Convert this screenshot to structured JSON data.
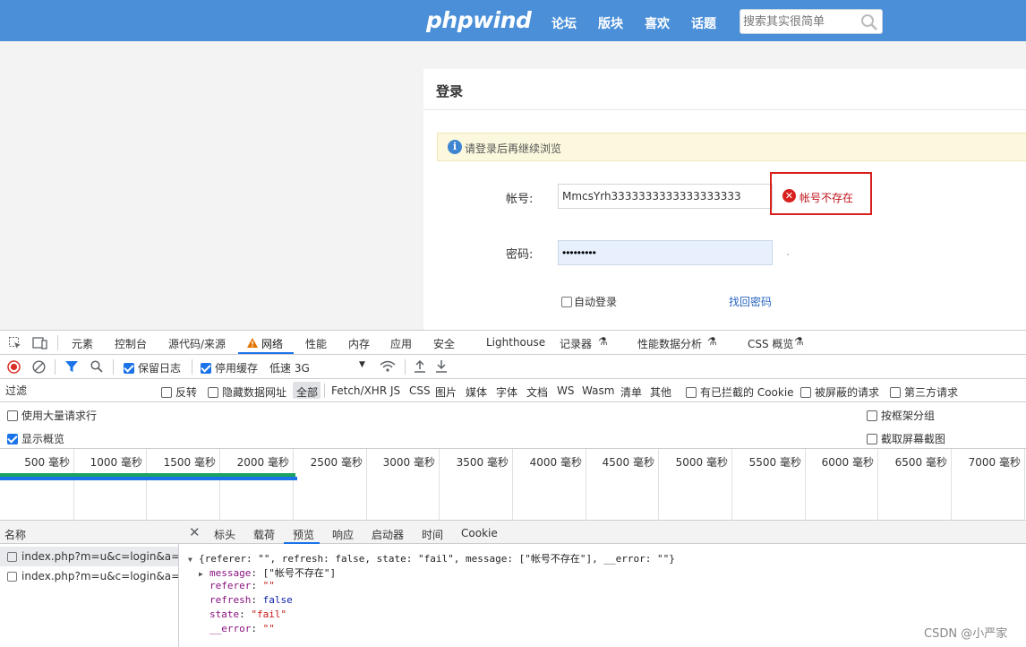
{
  "site": {
    "logo": "phpwind",
    "nav": [
      "论坛",
      "版块",
      "喜欢",
      "话题"
    ],
    "search_placeholder": "搜索其实很简单"
  },
  "login": {
    "title": "登录",
    "notice": "请登录后再继续浏览",
    "account_label": "帐号:",
    "account_value": "MmcsYrh3333333333333333333",
    "error_message": "帐号不存在",
    "password_label": "密码:",
    "password_value": "•••••••••",
    "auto_login": "自动登录",
    "find_password": "找回密码"
  },
  "devtools": {
    "tabs": [
      "元素",
      "控制台",
      "源代码/来源",
      "网络",
      "性能",
      "内存",
      "应用",
      "安全",
      "Lighthouse",
      "记录器",
      "性能数据分析",
      "CSS 概览"
    ],
    "active_tab": "网络",
    "toolbar": {
      "preserve_log": "保留日志",
      "disable_cache": "停用缓存",
      "throttle": "低速 3G"
    },
    "filter": {
      "placeholder": "过滤",
      "invert": "反转",
      "hide_data_urls": "隐藏数据网址",
      "types": [
        "全部",
        "Fetch/XHR",
        "JS",
        "CSS",
        "图片",
        "媒体",
        "字体",
        "文档",
        "WS",
        "Wasm",
        "清单",
        "其他"
      ],
      "blocked_cookies": "有已拦截的 Cookie",
      "blocked_requests": "被屏蔽的请求",
      "third_party": "第三方请求"
    },
    "options": {
      "big_rows": "使用大量请求行",
      "show_overview": "显示概览",
      "group_by_frame": "按框架分组",
      "capture_screenshots": "截取屏幕截图"
    },
    "timeline_ticks": [
      "500 毫秒",
      "1000 毫秒",
      "1500 毫秒",
      "2000 毫秒",
      "2500 毫秒",
      "3000 毫秒",
      "3500 毫秒",
      "4000 毫秒",
      "4500 毫秒",
      "5000 毫秒",
      "5500 毫秒",
      "6000 毫秒",
      "6500 毫秒",
      "7000 毫秒"
    ],
    "requests_header": "名称",
    "requests": [
      "index.php?m=u&c=login&a=...",
      "index.php?m=u&c=login&a=..."
    ],
    "detail_tabs": [
      "标头",
      "载荷",
      "预览",
      "响应",
      "启动器",
      "时间",
      "Cookie"
    ],
    "active_detail_tab": "预览",
    "preview": {
      "summary": "{referer: \"\", refresh: false, state: \"fail\", message: [\"帐号不存在\"], __error: \"\"}",
      "message_key": "message",
      "message_val": "[\"帐号不存在\"]",
      "referer_key": "referer",
      "referer_val": "\"\"",
      "refresh_key": "refresh",
      "refresh_val": "false",
      "state_key": "state",
      "state_val": "\"fail\"",
      "error_key": "__error",
      "error_val": "\"\""
    },
    "throughput_bar_end_ms": 2030
  },
  "watermark": "CSDN @小严家"
}
